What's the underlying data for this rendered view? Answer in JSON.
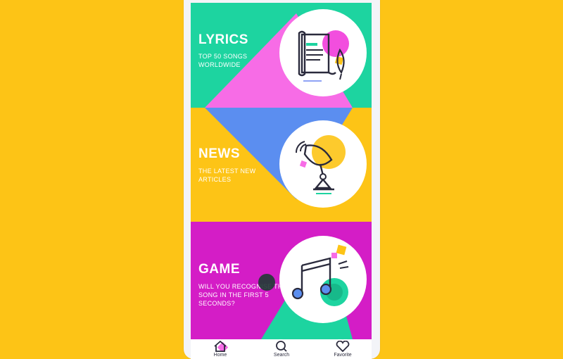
{
  "colors": {
    "background": "#FDC416",
    "teal": "#1DD4A0",
    "pink": "#F76CE6",
    "blue": "#5B8EF0",
    "yellow": "#FDC416",
    "magenta": "#D41DC6",
    "dark": "#2a2a3c"
  },
  "cards": [
    {
      "title": "LYRICS",
      "subtitle": "TOP 50 SONGS WORLDWIDE",
      "icon": "lyrics-scroll-icon"
    },
    {
      "title": "NEWS",
      "subtitle": "THE LATEST NEW ARTICLES",
      "icon": "satellite-dish-icon"
    },
    {
      "title": "GAME",
      "subtitle": "WILL YOU RECOGNISE THE SONG IN THE FIRST 5 SECONDS?",
      "icon": "music-note-icon"
    }
  ],
  "nav": {
    "home": "Home",
    "search": "Search",
    "favorite": "Favorite",
    "active": "home"
  }
}
